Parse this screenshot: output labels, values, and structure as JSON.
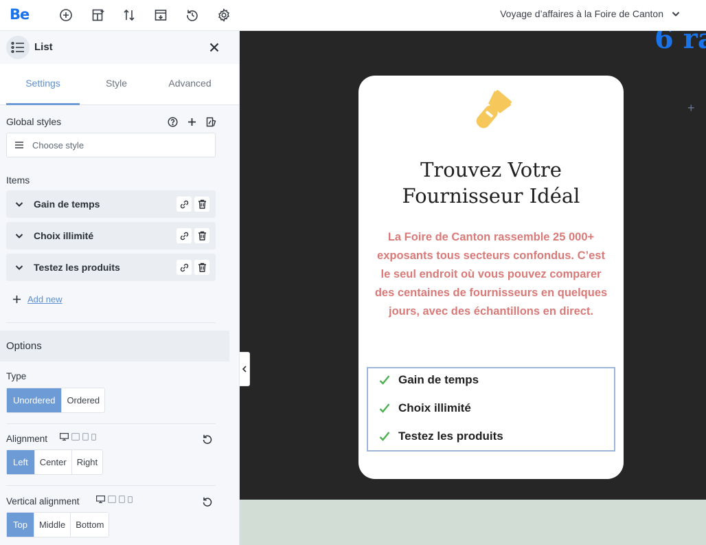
{
  "app": {
    "logo": "Be"
  },
  "toolbar": {
    "icons": [
      "add-circle-icon",
      "add-layout-icon",
      "sort-arrows-icon",
      "template-icon",
      "history-icon",
      "gear-icon"
    ],
    "page_title": "Voyage d’affaires à la Foire de Canton"
  },
  "panel": {
    "title": "List",
    "tabs": [
      "Settings",
      "Style",
      "Advanced"
    ],
    "active_tab": "Settings",
    "global_styles_label": "Global styles",
    "choose_style_placeholder": "Choose style",
    "items_label": "Items",
    "items": [
      {
        "label": "Gain de temps"
      },
      {
        "label": "Choix illimité"
      },
      {
        "label": "Testez les produits"
      }
    ],
    "add_new": "Add new",
    "options": {
      "heading": "Options",
      "type": {
        "label": "Type",
        "options": [
          "Unordered",
          "Ordered"
        ],
        "selected": "Unordered"
      },
      "alignment": {
        "label": "Alignment",
        "options": [
          "Left",
          "Center",
          "Right"
        ],
        "selected": "Left"
      },
      "vertical_alignment": {
        "label": "Vertical alignment",
        "options": [
          "Top",
          "Middle",
          "Bottom"
        ],
        "selected": "Top"
      }
    }
  },
  "canvas": {
    "top_fragment": "6 ra",
    "card": {
      "icon": "flashlight-icon",
      "title_line1": "Trouvez Votre",
      "title_line2": "Fournisseur Idéal",
      "description": "La Foire de Canton rassemble 25 000+ exposants tous secteurs confondus. C’est le seul endroit où vous pouvez comparer des centaines de fournisseurs en quelques jours, avec des échantillons en direct.",
      "list": [
        "Gain de temps",
        "Choix illimité",
        "Testez les produits"
      ]
    }
  },
  "colors": {
    "accent": "#6d9bd6",
    "brand_blue": "#1a73e8",
    "canvas_dark": "#262626",
    "desc_text": "#d87a78",
    "check_green": "#4caf50",
    "flashlight_yellow": "#f6c75a",
    "footer_green": "#d2ddd6"
  }
}
